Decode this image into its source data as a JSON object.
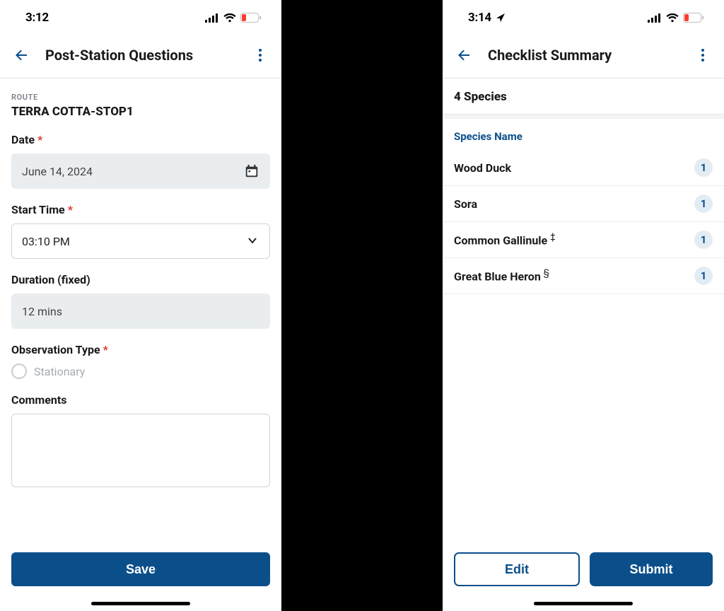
{
  "left": {
    "status": {
      "time": "3:12",
      "battery": "18"
    },
    "nav": {
      "title": "Post-Station Questions"
    },
    "route": {
      "label": "ROUTE",
      "value": "TERRA COTTA-STOP1"
    },
    "fields": {
      "date": {
        "label": "Date",
        "value": "June 14, 2024"
      },
      "start_time": {
        "label": "Start Time",
        "value": "03:10 PM"
      },
      "duration": {
        "label": "Duration (fixed)",
        "value": "12 mins"
      },
      "obs_type": {
        "label": "Observation Type",
        "option": "Stationary"
      },
      "comments": {
        "label": "Comments",
        "value": ""
      }
    },
    "save_label": "Save"
  },
  "right": {
    "status": {
      "time": "3:14",
      "battery": "18"
    },
    "nav": {
      "title": "Checklist Summary"
    },
    "species_count": "4 Species",
    "table_header": "Species Name",
    "species": [
      {
        "name": "Wood Duck",
        "symbol": "",
        "count": "1"
      },
      {
        "name": "Sora",
        "symbol": "",
        "count": "1"
      },
      {
        "name": "Common Gallinule",
        "symbol": "‡",
        "count": "1"
      },
      {
        "name": "Great Blue Heron",
        "symbol": "§",
        "count": "1"
      }
    ],
    "edit_label": "Edit",
    "submit_label": "Submit"
  }
}
